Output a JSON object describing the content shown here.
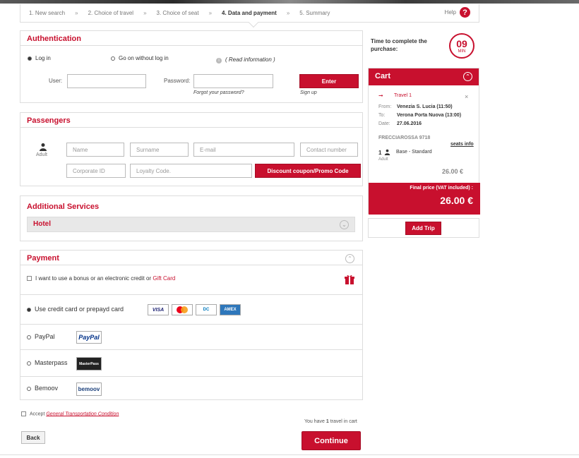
{
  "steps": {
    "items": [
      "1. New search",
      "2. Choice of travel",
      "3. Choice of seat",
      "4. Data and payment",
      "5. Summary"
    ],
    "separator": "»",
    "help_label": "Help",
    "help_icon": "question-icon"
  },
  "auth": {
    "title": "Authentication",
    "login_label": "Log in",
    "guest_label": "Go on without log in",
    "read_info": "( Read information )",
    "user_label": "User:",
    "password_label": "Password:",
    "enter_label": "Enter",
    "forgot_label": "Forgot your password?",
    "signup_label": "Sign up"
  },
  "passengers": {
    "title": "Passengers",
    "type_label": "Adult",
    "name_placeholder": "Name",
    "surname_placeholder": "Surname",
    "email_placeholder": "E-mail",
    "contact_placeholder": "Contact number",
    "corporate_placeholder": "Corporate ID",
    "loyalty_placeholder": "Loyalty Code.",
    "discount_label": "Discount coupon/Promo Code"
  },
  "additional": {
    "title": "Additional Services",
    "hotel_label": "Hotel"
  },
  "payment": {
    "title": "Payment",
    "bonus_text": "I want to use a bonus or an electronic credit or ",
    "gift_card_label": "Gift Card",
    "credit_card_label": "Use credit card or prepayd card",
    "card_logos": [
      "VISA",
      "MC",
      "DC",
      "AMEX"
    ],
    "paypal_label": "PayPal",
    "paypal_logo": "PayPal",
    "masterpass_label": "Masterpass",
    "masterpass_logo": "MasterPass",
    "bemoov_label": "Bemoov",
    "bemoov_logo": "bemoov"
  },
  "terms": {
    "accept_label": "Accept",
    "link_label": "General Transportation Condition"
  },
  "cart_info": {
    "prefix": "You have ",
    "count": "1",
    "suffix": " travel in cart"
  },
  "buttons": {
    "back_label": "Back",
    "continue_label": "Continue"
  },
  "timer": {
    "text": "Time to complete the purchase:",
    "minutes": "09",
    "unit": "MIN"
  },
  "cart": {
    "title": "Cart",
    "travel_label": "Travel 1",
    "from_label": "From:",
    "from_value": "Venezia S. Lucia (11:50)",
    "to_label": "To:",
    "to_value": "Verona Porta Nuova (13:00)",
    "date_label": "Date:",
    "date_value": "27.06.2016",
    "train_value": "FRECCIAROSSA  9718",
    "seats_info": "seats info",
    "pax_count": "1",
    "pax_type": "Adult",
    "fare": "Base  -  Standard",
    "subtotal": "26.00 €",
    "final_label": "Final price (VAT included) :",
    "final_price": "26.00 €",
    "add_trip_label": "Add Trip"
  },
  "colors": {
    "accent": "#c8102e",
    "border": "#dddddd"
  }
}
